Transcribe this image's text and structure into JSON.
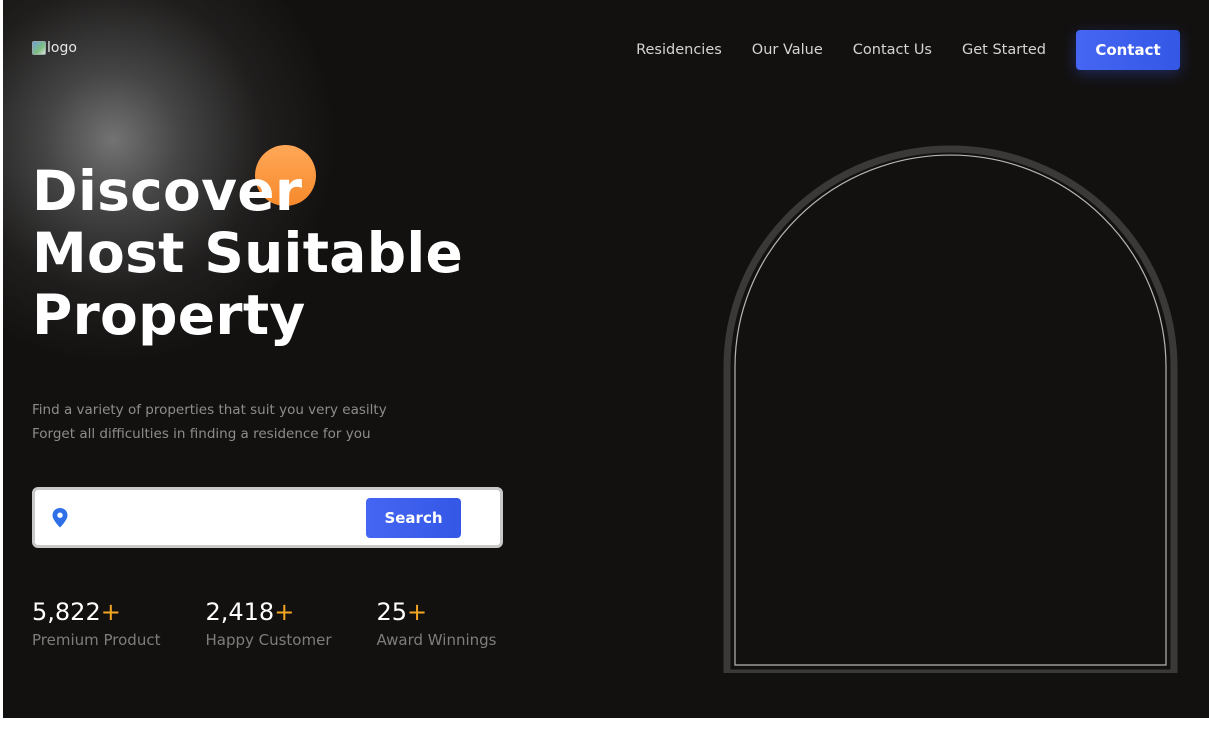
{
  "header": {
    "logo_alt": "logo",
    "nav": [
      "Residencies",
      "Our Value",
      "Contact Us",
      "Get Started"
    ],
    "cta_label": "Contact"
  },
  "hero": {
    "title_lines": [
      "Discover",
      "Most Suitable",
      "Property"
    ],
    "subtitle_lines": [
      "Find a variety of properties that suit you very easilty",
      "Forget all difficulties in finding a residence for you"
    ],
    "search": {
      "icon": "location-pin-icon",
      "value": "",
      "placeholder": "",
      "button_label": "Search"
    },
    "stats": [
      {
        "value": "5,822",
        "suffix": "+",
        "label": "Premium Product"
      },
      {
        "value": "2,418",
        "suffix": "+",
        "label": "Happy Customer"
      },
      {
        "value": "25",
        "suffix": "+",
        "label": "Award Winnings"
      }
    ]
  },
  "colors": {
    "background": "#131110",
    "accent_blue": "#4066ff",
    "accent_orange": "#f7892b",
    "stat_plus": "#f5a623"
  }
}
